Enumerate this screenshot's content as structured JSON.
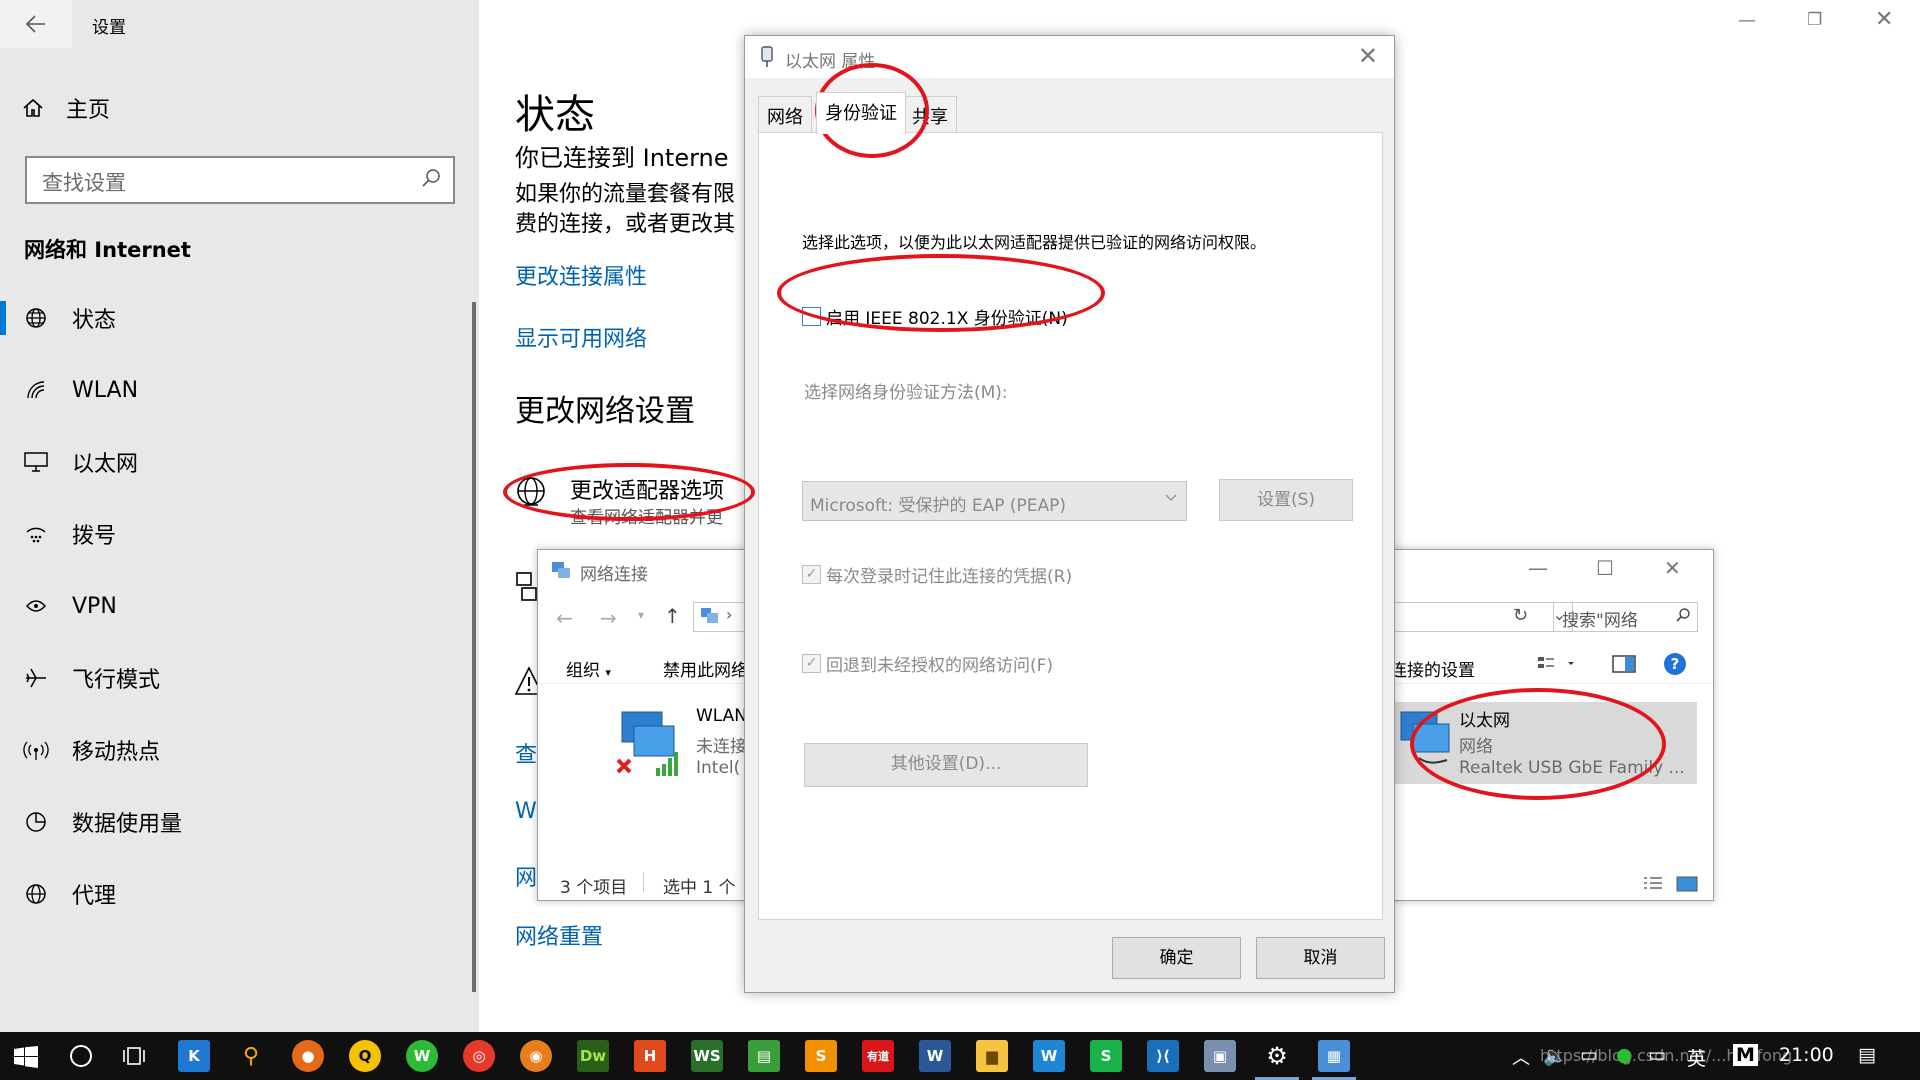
{
  "settings": {
    "app_title": "设置",
    "home": "主页",
    "search_placeholder": "查找设置",
    "section": "网络和 Internet",
    "nav": [
      "状态",
      "WLAN",
      "以太网",
      "拨号",
      "VPN",
      "飞行模式",
      "移动热点",
      "数据使用量",
      "代理"
    ],
    "main": {
      "title": "状态",
      "connected_line": "你已连接到 Interne",
      "info_line1": "如果你的流量套餐有限",
      "info_line2": "费的连接，或者更改其",
      "link_change_props": "更改连接属性",
      "link_show_networks": "显示可用网络",
      "change_settings_heading": "更改网络设置",
      "adapter_option_title": "更改适配器选项",
      "adapter_option_sub": "查看网络适配器并更",
      "link_partial_1": "查",
      "link_partial_2": "W",
      "link_partial_3": "网",
      "link_reset": "网络重置"
    }
  },
  "netconn": {
    "title": "网络连接",
    "search_placeholder": "搜索\"网络",
    "cmd_organize": "组织",
    "cmd_disable": "禁用此网络",
    "cmd_settings": "连接的设置",
    "wlan": {
      "name": "WLAN",
      "status": "未连接",
      "device": "Intel("
    },
    "ethernet": {
      "name": "以太网",
      "status": "网络",
      "device": "Realtek USB GbE Family ..."
    },
    "status_count": "3 个项目",
    "status_selected": "选中 1 个"
  },
  "dialog": {
    "title": "以太网 属性",
    "tabs": [
      "网络",
      "身份验证",
      "共享"
    ],
    "description": "选择此选项，以便为此以太网适配器提供已验证的网络访问权限。",
    "enable_8021x": "启用 IEEE 802.1X 身份验证(N)",
    "method_label": "选择网络身份验证方法(M):",
    "method_value": "Microsoft: 受保护的 EAP (PEAP)",
    "settings_button": "设置(S)",
    "remember_creds": "每次登录时记住此连接的凭据(R)",
    "fallback": "回退到未经授权的网络访问(F)",
    "additional_settings": "其他设置(D)...",
    "ok": "确定",
    "cancel": "取消"
  },
  "taskbar": {
    "ime": "英",
    "time": "21:00",
    "watermark": "https://blog.csdn.net/...henfong"
  },
  "colors": {
    "accent": "#0078d7",
    "link": "#0063b1",
    "annotation": "#e3141c"
  }
}
